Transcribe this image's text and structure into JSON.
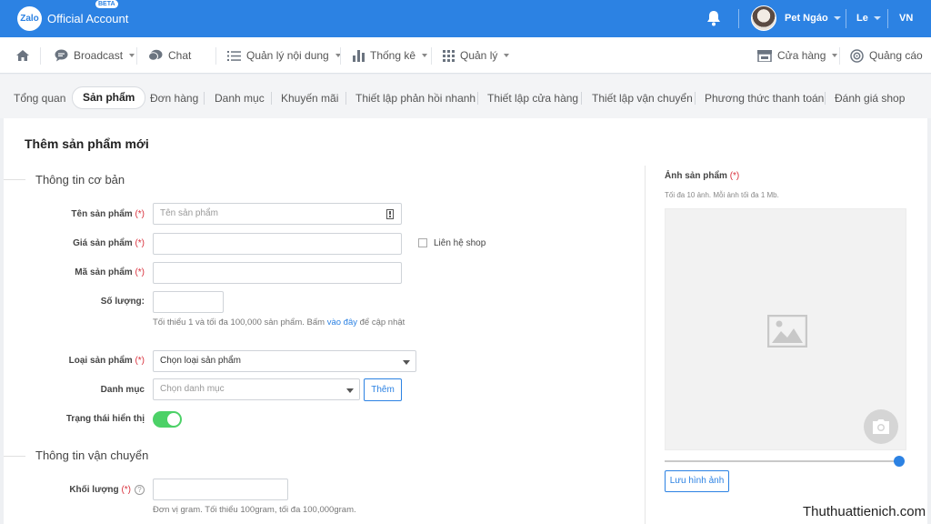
{
  "header": {
    "logo_mark": "Zalo",
    "logo_text": "Official Account",
    "beta": "BETA",
    "user_name": "Pet Ngáo",
    "user_short": "Le",
    "language": "VN"
  },
  "nav": {
    "broadcast": "Broadcast",
    "chat": "Chat",
    "content": "Quản lý nội dung",
    "stats": "Thống kê",
    "manage": "Quản lý",
    "store": "Cửa hàng",
    "ads": "Quảng cáo"
  },
  "subtabs": [
    "Tổng quan",
    "Sản phẩm",
    "Đơn hàng",
    "Danh mục",
    "Khuyến mãi",
    "Thiết lập phản hồi nhanh",
    "Thiết lập cửa hàng",
    "Thiết lập vận chuyển",
    "Phương thức thanh toán",
    "Đánh giá shop"
  ],
  "form": {
    "title": "Thêm sản phẩm mới",
    "section_basic": "Thông tin cơ bản",
    "name_label": "Tên sản phẩm",
    "name_placeholder": "Tên sản phẩm",
    "price_label": "Giá sản phẩm",
    "contact_label": "Liên hệ shop",
    "code_label": "Mã sản phẩm",
    "qty_label": "Số lượng:",
    "qty_hint": "Tối thiểu 1 và tối đa 100,000 sản phẩm. Bấm",
    "qty_hint_link": "vào đây",
    "qty_hint_end": "để cập nhật",
    "type_label": "Loại sản phẩm",
    "type_value": "Chọn loại sản phẩm",
    "category_label": "Danh mục",
    "category_placeholder": "Chọn danh mục",
    "add_button": "Thêm",
    "status_label": "Trạng thái hiển thị",
    "status_on": true,
    "section_shipping": "Thông tin vận chuyển",
    "weight_label": "Khối lượng",
    "weight_hint": "Đơn vị gram. Tối thiểu 100gram, tối đa 100,000gram.",
    "required_mark": "(*)"
  },
  "image_panel": {
    "title": "Ảnh sản phẩm",
    "hint": "Tối đa 10 ảnh. Mỗi ảnh tối đa 1 Mb.",
    "save_button": "Lưu hình ảnh",
    "zoom_level": 1.0
  },
  "watermark": "Thuthuattienich.com",
  "colors": {
    "brand": "#2c82e3",
    "required": "#d9303c",
    "toggle_on": "#4cd167"
  }
}
